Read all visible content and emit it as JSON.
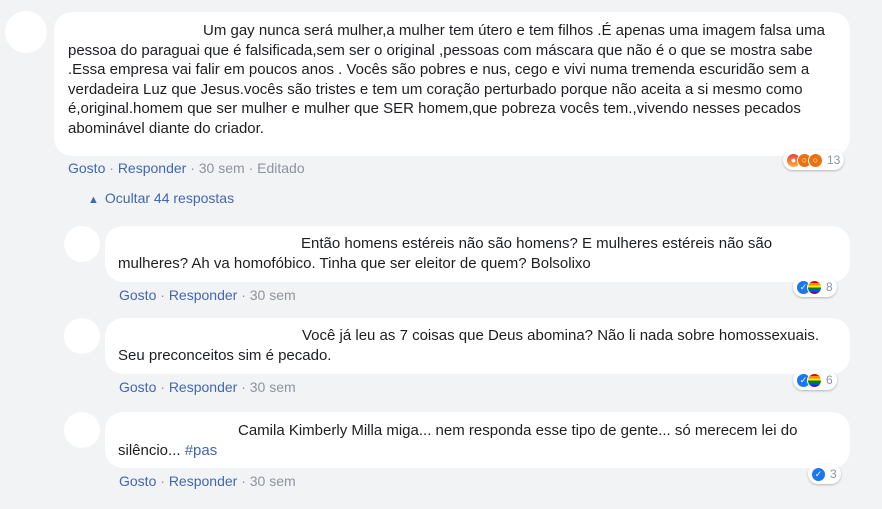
{
  "comment": {
    "text": "Um gay nunca será mulher,a mulher tem útero e tem filhos .É apenas uma imagem falsa uma pessoa do paraguai que é falsificada,sem ser o original ,pessoas com máscara que não é o que se mostra sabe .Essa empresa vai falir em poucos anos . Vocês são pobres e nus, cego e vivi numa tremenda escuridão sem a verdadeira Luz que Jesus.vocês são tristes e tem um coração perturbado porque não aceita a si mesmo como é,original.homem que ser mulher e mulher que SER homem,que pobreza vocês tem.,vivendo nesses pecados abominável diante do criador.",
    "like_label": "Gosto",
    "reply_label": "Responder",
    "time": "30 sem",
    "edited_label": "Editado",
    "reaction_count": "13",
    "reaction_icons": [
      "angry-icon",
      "wow-icon",
      "wow-icon"
    ]
  },
  "replies_toggle": {
    "label": "Ocultar 44 respostas",
    "icon": "chevron-up-icon"
  },
  "replies": [
    {
      "text": "Então homens estéreis não são homens? E mulheres estéreis não são mulheres? Ah va homofóbico. Tinha que ser eleitor de quem? Bolsolixo",
      "like_label": "Gosto",
      "reply_label": "Responder",
      "time": "30 sem",
      "reaction_count": "8",
      "reaction_icons": [
        "like-icon",
        "pride-icon"
      ]
    },
    {
      "text": "Você já leu as 7 coisas que Deus abomina? Não li nada sobre homossexuais. Seu preconceitos sim é pecado.",
      "like_label": "Gosto",
      "reply_label": "Responder",
      "time": "30 sem",
      "reaction_count": "6",
      "reaction_icons": [
        "like-icon",
        "pride-icon"
      ]
    },
    {
      "text": "Camila Kimberly Milla miga... nem responda esse tipo de gente... só merecem lei do silêncio...",
      "hashtag": "#pas",
      "like_label": "Gosto",
      "reply_label": "Responder",
      "time": "30 sem",
      "reaction_count": "3",
      "reaction_icons": [
        "like-icon"
      ]
    }
  ],
  "colors": {
    "background": "#f2f3f5",
    "link": "#4267b2",
    "meta": "#8d949e",
    "like": "#1877f2"
  }
}
